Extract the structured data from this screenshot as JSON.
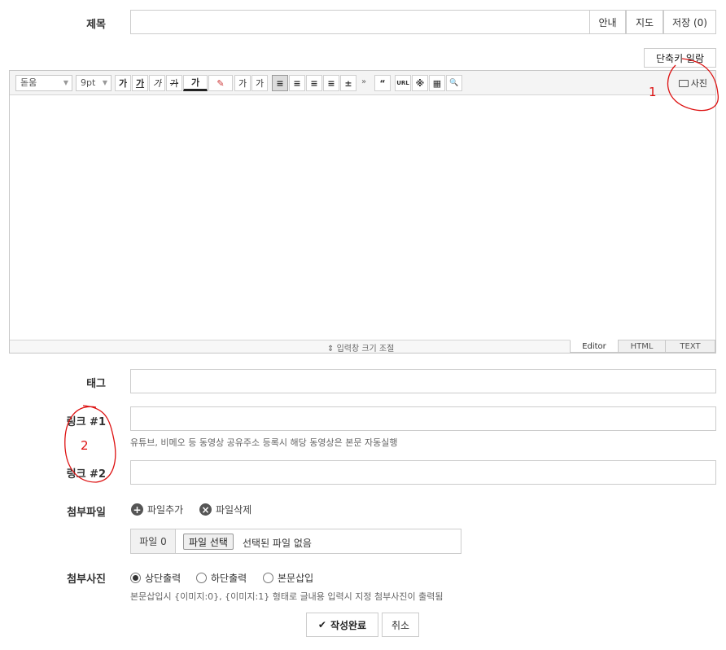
{
  "title_row": {
    "label": "제목",
    "value": "",
    "buttons": [
      "안내",
      "지도",
      "저장 (0)"
    ]
  },
  "shortcut_button": "단축키 일람",
  "editor": {
    "font_select": "돋움",
    "size_select": "9pt",
    "format_buttons": [
      "가",
      "가",
      "가",
      "가",
      "가",
      "✎",
      "가",
      "가"
    ],
    "align_buttons": [
      "≡",
      "≡",
      "≡",
      "≡",
      "±"
    ],
    "more_glyph": "»",
    "insert_buttons": [
      "“",
      "URL",
      "※",
      "▦",
      "🔍"
    ],
    "photo_button": "사진",
    "resize_label": "입력창 크기 조절",
    "tabs": [
      "Editor",
      "HTML",
      "TEXT"
    ],
    "active_tab": "Editor"
  },
  "tag": {
    "label": "태그",
    "value": ""
  },
  "link1": {
    "label": "링크 #1",
    "value": "",
    "help": "유튜브, 비메오 등 동영상 공유주소 등록시 해당 동영상은 본문 자동실행"
  },
  "link2": {
    "label": "링크 #2",
    "value": ""
  },
  "attach": {
    "label": "첨부파일",
    "add": "파일추가",
    "remove": "파일삭제",
    "file_count": "파일 0",
    "choose": "파일 선택",
    "none": "선택된 파일 없음"
  },
  "photo_attach": {
    "label": "첨부사진",
    "options": [
      "상단출력",
      "하단출력",
      "본문삽입"
    ],
    "selected": "상단출력",
    "help": "본문삽입시 {이미지:0}, {이미지:1} 형태로 글내용 입력시 지정 첨부사진이 출력됨"
  },
  "actions": {
    "submit": "작성완료",
    "cancel": "취소"
  },
  "annotations": {
    "mark1": "1",
    "mark2": "2",
    "color": "#dd1111"
  }
}
